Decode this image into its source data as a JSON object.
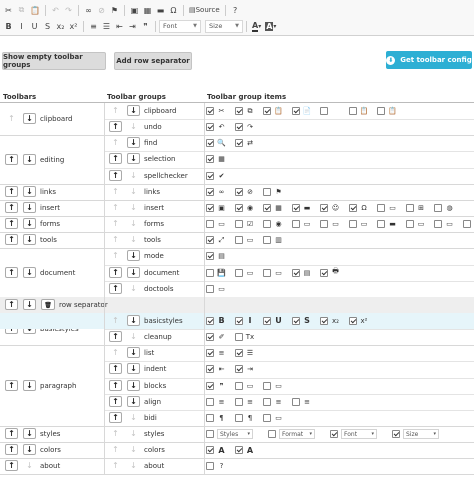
{
  "editor_toolbar": {
    "row1": [
      {
        "name": "cut-icon",
        "glyph": "✂",
        "dim": false
      },
      {
        "name": "copy-icon",
        "glyph": "⧉",
        "dim": true
      },
      {
        "name": "paste-icon",
        "glyph": "📋",
        "dim": true
      },
      {
        "sep": true
      },
      {
        "name": "undo-icon",
        "glyph": "↶",
        "dim": true
      },
      {
        "name": "redo-icon",
        "glyph": "↷",
        "dim": true
      },
      {
        "sep": true
      },
      {
        "name": "link-icon",
        "glyph": "∞",
        "dim": false
      },
      {
        "name": "unlink-icon",
        "glyph": "⊘",
        "dim": true
      },
      {
        "name": "anchor-icon",
        "glyph": "⚑",
        "dim": false
      },
      {
        "sep": true
      },
      {
        "name": "image-icon",
        "glyph": "▣",
        "dim": false
      },
      {
        "name": "table-icon",
        "glyph": "▦",
        "dim": false
      },
      {
        "name": "horizontal-rule-icon",
        "glyph": "▬",
        "dim": false
      },
      {
        "name": "special-char-icon",
        "glyph": "Ω",
        "dim": false
      },
      {
        "sep": true
      },
      {
        "name": "source-icon",
        "glyph": "▤",
        "dim": false,
        "label": "Source"
      },
      {
        "sep": true
      },
      {
        "name": "about-icon",
        "glyph": "?",
        "dim": false
      }
    ],
    "row2": [
      {
        "name": "bold-icon",
        "glyph": "B",
        "bold": true
      },
      {
        "name": "italic-icon",
        "glyph": "I"
      },
      {
        "name": "underline-icon",
        "glyph": "U"
      },
      {
        "name": "strike-icon",
        "glyph": "S"
      },
      {
        "name": "subscript-icon",
        "glyph": "x₂"
      },
      {
        "name": "superscript-icon",
        "glyph": "x²"
      },
      {
        "sep": true
      },
      {
        "name": "numbered-list-icon",
        "glyph": "≡"
      },
      {
        "name": "bullet-list-icon",
        "glyph": "☰"
      },
      {
        "name": "outdent-icon",
        "glyph": "⇤"
      },
      {
        "name": "indent-icon",
        "glyph": "⇥"
      },
      {
        "name": "blockquote-icon",
        "glyph": "❞"
      },
      {
        "sep": true
      }
    ],
    "font_combo": "Font",
    "size_combo": "Size",
    "text_color_label": "A",
    "bg_color_label": "A"
  },
  "buttons": {
    "show_empty": "Show empty toolbar groups",
    "add_separator": "Add row separator",
    "get_config": "Get toolbar config"
  },
  "headers": {
    "toolbars": "Toolbars",
    "groups": "Toolbar groups",
    "items": "Toolbar group items"
  },
  "toolbars": [
    {
      "name": "clipboard",
      "groups": [
        {
          "name": "clipboard",
          "items": [
            [
              "on",
              "✂"
            ],
            [
              "on",
              "⧉"
            ],
            [
              "on",
              "📋"
            ],
            [
              "on",
              "📄"
            ],
            [
              "off",
              ""
            ],
            [
              "off",
              "📋"
            ],
            [
              "off",
              "📋"
            ]
          ]
        },
        {
          "name": "undo",
          "items": [
            [
              "on",
              "↶"
            ],
            [
              "on",
              "↷"
            ]
          ]
        }
      ]
    },
    {
      "name": "editing",
      "groups": [
        {
          "name": "find",
          "items": [
            [
              "on",
              "🔍"
            ],
            [
              "on",
              "⇄"
            ]
          ]
        },
        {
          "name": "selection",
          "items": [
            [
              "on",
              "▦"
            ]
          ]
        },
        {
          "name": "spellchecker",
          "items": [
            [
              "on",
              "✔"
            ]
          ]
        }
      ]
    },
    {
      "name": "links",
      "groups": [
        {
          "name": "links",
          "items": [
            [
              "on",
              "∞"
            ],
            [
              "on",
              "⊘"
            ],
            [
              "off",
              "⚑"
            ]
          ]
        }
      ]
    },
    {
      "name": "insert",
      "groups": [
        {
          "name": "insert",
          "items": [
            [
              "on",
              "▣"
            ],
            [
              "on",
              "◉"
            ],
            [
              "on",
              "▦"
            ],
            [
              "on",
              "▬"
            ],
            [
              "on",
              "☺"
            ],
            [
              "on",
              "Ω"
            ],
            [
              "off",
              "▭"
            ],
            [
              "off",
              "⊞"
            ],
            [
              "off",
              "◍"
            ]
          ]
        }
      ]
    },
    {
      "name": "forms",
      "groups": [
        {
          "name": "forms",
          "items": [
            [
              "off",
              "▭"
            ],
            [
              "off",
              "☑"
            ],
            [
              "off",
              "◉"
            ],
            [
              "off",
              "▭"
            ],
            [
              "off",
              "▭"
            ],
            [
              "off",
              "▭"
            ],
            [
              "off",
              "▬"
            ],
            [
              "off",
              "▭"
            ],
            [
              "off",
              "▭"
            ],
            [
              "off",
              "✎"
            ]
          ]
        }
      ]
    },
    {
      "name": "tools",
      "groups": [
        {
          "name": "tools",
          "items": [
            [
              "on",
              "⤢"
            ],
            [
              "off",
              "▭"
            ],
            [
              "off",
              "▥"
            ]
          ]
        }
      ]
    },
    {
      "name": "document",
      "groups": [
        {
          "name": "mode",
          "items": [
            [
              "on",
              "▤"
            ]
          ]
        },
        {
          "name": "document",
          "items": [
            [
              "off",
              "💾"
            ],
            [
              "off",
              "▭"
            ],
            [
              "off",
              "▭"
            ],
            [
              "on",
              "▤"
            ],
            [
              "on",
              "🖶"
            ]
          ]
        },
        {
          "name": "doctools",
          "items": [
            [
              "off",
              "▭"
            ]
          ]
        }
      ]
    },
    {
      "name": "row separator",
      "separator": true,
      "groups": []
    },
    {
      "name": "basicstyles",
      "highlight": true,
      "groups": [
        {
          "name": "basicstyles",
          "highlight": true,
          "items": [
            [
              "on",
              "B"
            ],
            [
              "on",
              "I"
            ],
            [
              "on",
              "U"
            ],
            [
              "on",
              "S"
            ],
            [
              "on",
              "x₂"
            ],
            [
              "on",
              "x²"
            ]
          ]
        },
        {
          "name": "cleanup",
          "items": [
            [
              "on",
              "✐"
            ],
            [
              "off",
              "Tx"
            ]
          ]
        }
      ]
    },
    {
      "name": "paragraph",
      "groups": [
        {
          "name": "list",
          "items": [
            [
              "on",
              "≡"
            ],
            [
              "on",
              "☰"
            ]
          ]
        },
        {
          "name": "indent",
          "items": [
            [
              "on",
              "⇤"
            ],
            [
              "on",
              "⇥"
            ]
          ]
        },
        {
          "name": "blocks",
          "items": [
            [
              "on",
              "❞"
            ],
            [
              "off",
              "▭"
            ],
            [
              "off",
              "▭"
            ]
          ]
        },
        {
          "name": "align",
          "items": [
            [
              "off",
              "≡"
            ],
            [
              "off",
              "≡"
            ],
            [
              "off",
              "≡"
            ],
            [
              "off",
              "≡"
            ]
          ]
        },
        {
          "name": "bidi",
          "items": [
            [
              "off",
              "¶"
            ],
            [
              "off",
              "¶"
            ],
            [
              "off",
              "▭"
            ]
          ]
        }
      ]
    },
    {
      "name": "styles",
      "groups": [
        {
          "name": "styles",
          "items": [],
          "combos": [
            [
              "off",
              "Styles"
            ],
            [
              "off",
              "Format"
            ],
            [
              "on",
              "Font"
            ],
            [
              "on",
              "Size"
            ]
          ]
        }
      ]
    },
    {
      "name": "colors",
      "groups": [
        {
          "name": "colors",
          "items": [
            [
              "on",
              "A"
            ],
            [
              "on",
              "A"
            ]
          ]
        }
      ]
    },
    {
      "name": "about",
      "groups": [
        {
          "name": "about",
          "items": [
            [
              "off",
              "?"
            ]
          ]
        }
      ]
    }
  ]
}
